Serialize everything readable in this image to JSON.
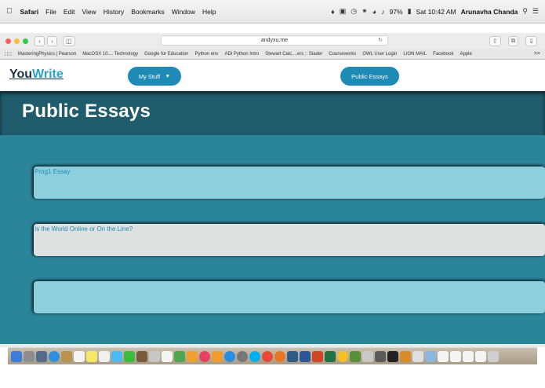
{
  "menubar": {
    "app": "Safari",
    "items": [
      "File",
      "Edit",
      "View",
      "History",
      "Bookmarks",
      "Window",
      "Help"
    ],
    "battery": "97%",
    "datetime": "Sat 10:42 AM",
    "user": "Arunavha Chanda"
  },
  "toolbar": {
    "url": "andyxu.me"
  },
  "bookmarks": {
    "items": [
      "MasteringPhysics | Pearson",
      "MacOSX 10.... Technology",
      "Google for Education",
      "Python env",
      "ADi Python Intro",
      "Stewart Calc....ers :: Slader",
      "Courseworks",
      "OWL User Login",
      "LION MAIL",
      "Facebook",
      "Apple"
    ],
    "more": ">>"
  },
  "site": {
    "logo_you": "You",
    "logo_write": "Write",
    "my_stuff": "My Stuff",
    "public_essays_btn": "Public Essays",
    "page_title": "Public Essays"
  },
  "essays": [
    {
      "title": "Prog1 Essay"
    },
    {
      "title": "Is the World Online or On the Line?"
    },
    {
      "title": ""
    }
  ],
  "colors": {
    "accent": "#1d8bb6",
    "hero": "#1f5c6c",
    "content_bg": "#2b8599",
    "card_blue": "#8ecfdd",
    "card_grey": "#dfe0e0"
  }
}
